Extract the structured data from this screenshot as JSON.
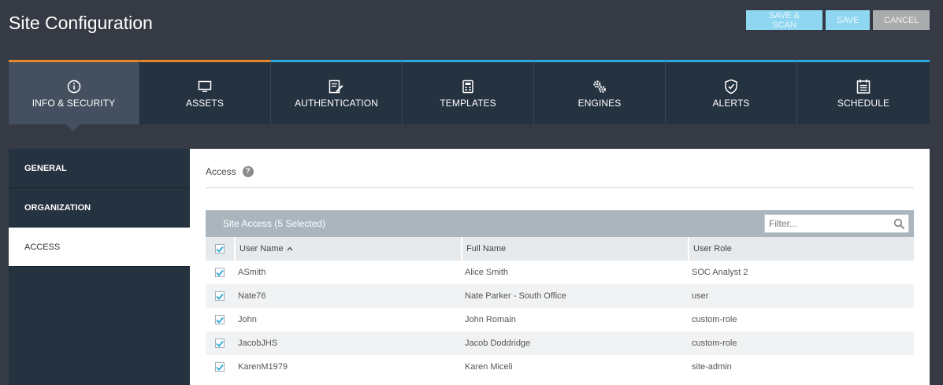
{
  "page": {
    "title": "Site Configuration"
  },
  "actions": {
    "save_scan": "SAVE & SCAN",
    "save": "SAVE",
    "cancel": "CANCEL"
  },
  "tabs": [
    {
      "label": "INFO & SECURITY",
      "icon": "info-icon"
    },
    {
      "label": "ASSETS",
      "icon": "monitor-icon"
    },
    {
      "label": "AUTHENTICATION",
      "icon": "edit-form-icon"
    },
    {
      "label": "TEMPLATES",
      "icon": "template-icon"
    },
    {
      "label": "ENGINES",
      "icon": "gears-icon"
    },
    {
      "label": "ALERTS",
      "icon": "shield-check-icon"
    },
    {
      "label": "SCHEDULE",
      "icon": "calendar-icon"
    }
  ],
  "sidebar": {
    "items": [
      {
        "label": "GENERAL"
      },
      {
        "label": "ORGANIZATION"
      },
      {
        "label": "ACCESS"
      }
    ]
  },
  "access": {
    "title": "Access",
    "help": "?",
    "grid_title": "Site Access (5 Selected)",
    "filter_placeholder": "Filter...",
    "columns": {
      "user": "User Name",
      "full": "Full Name",
      "role": "User Role"
    },
    "rows": [
      {
        "user": "ASmith",
        "full": "Alice Smith",
        "role": "SOC Analyst 2",
        "checked": true
      },
      {
        "user": "Nate76",
        "full": "Nate Parker - South Office",
        "role": "user",
        "checked": true
      },
      {
        "user": "John",
        "full": "John Romain",
        "role": "custom-role",
        "checked": true
      },
      {
        "user": "JacobJHS",
        "full": "Jacob Doddridge",
        "role": "custom-role",
        "checked": true
      },
      {
        "user": "KarenM1979",
        "full": "Karen Miceli",
        "role": "site-admin",
        "checked": true
      }
    ]
  },
  "colors": {
    "tab_active_accent": "#e3892b",
    "tab_accent": "#2ba7dd",
    "check": "#2ba7dd"
  }
}
